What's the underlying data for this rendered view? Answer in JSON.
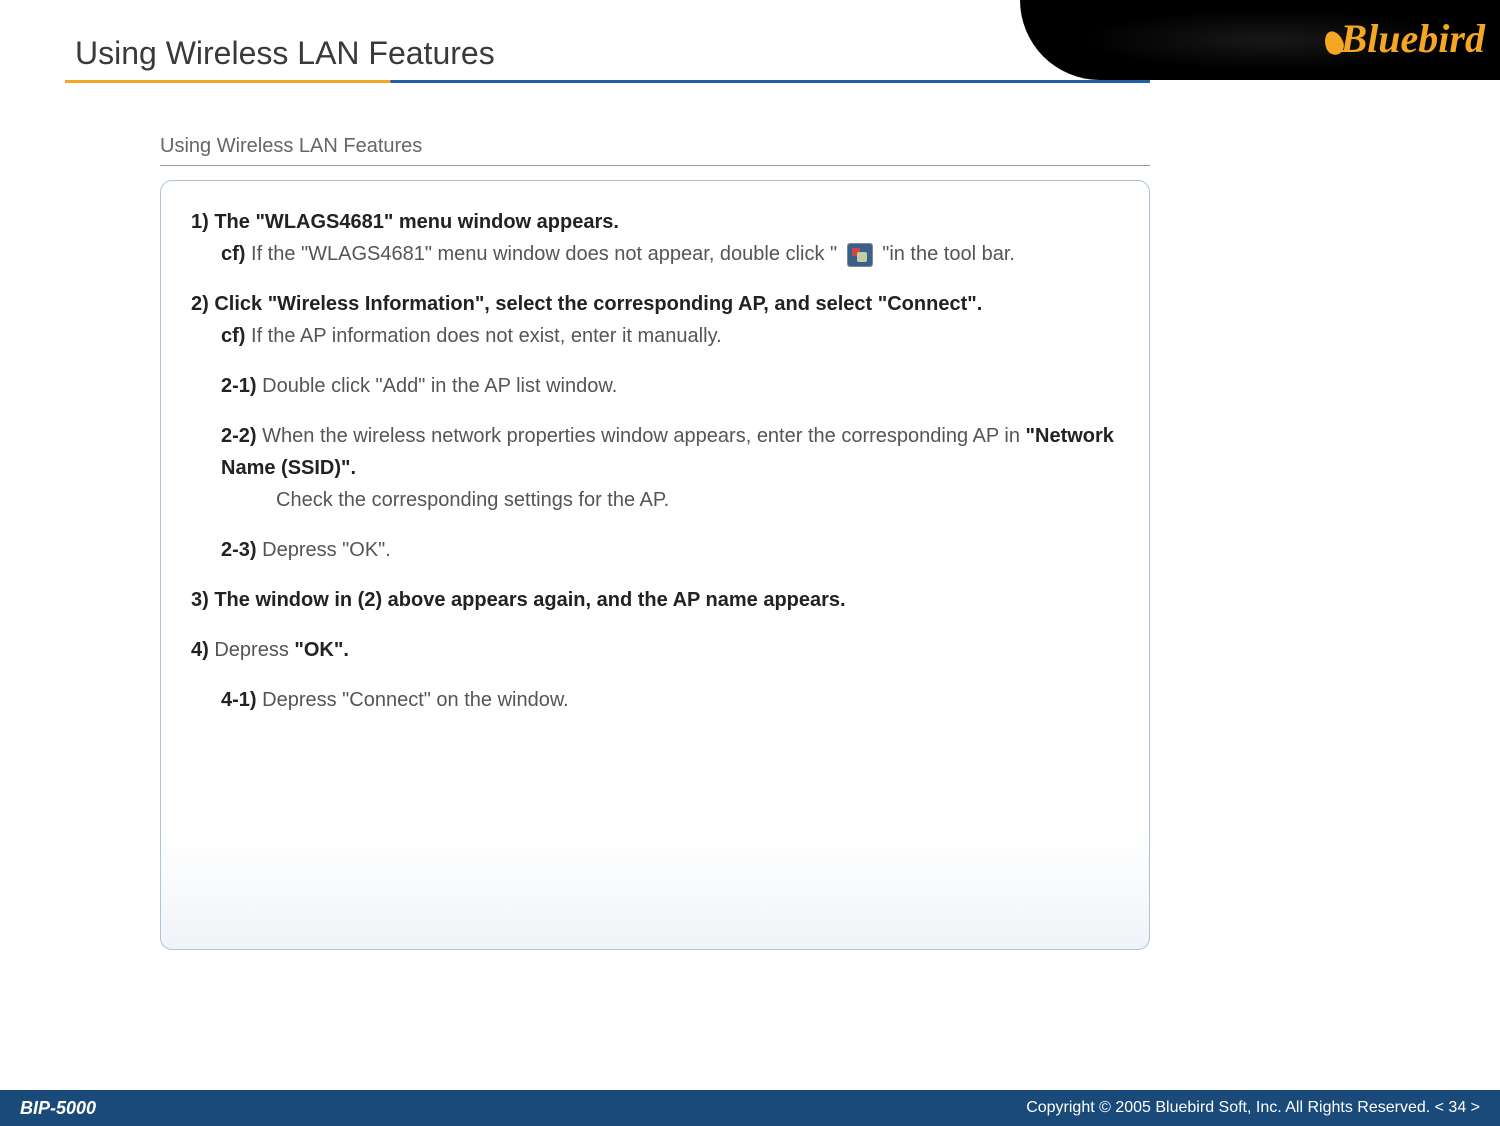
{
  "header": {
    "title": "Using Wireless LAN Features",
    "logo": "Bluebird"
  },
  "section": {
    "label": "Using Wireless LAN Features"
  },
  "content": {
    "step1_bold": "1) The \"WLAGS4681\" menu window appears.",
    "step1_cf_label": "cf)",
    "step1_cf_text1": " If the \"WLAGS4681\" menu window does not appear, double click \" ",
    "step1_cf_text2": " \"in the tool bar.",
    "step2_bold": "2) Click \"Wireless Information\", select the corresponding AP, and select \"Connect\".",
    "step2_cf_label": "cf)",
    "step2_cf_text": " If the AP information does not exist, enter it manually.",
    "step2_1_label": "2-1)",
    "step2_1_text": " Double click \"Add\" in the AP list window.",
    "step2_2_label": "2-2)",
    "step2_2_text1": " When the wireless network properties window appears, enter the corresponding AP in ",
    "step2_2_bold": "\"Network Name (SSID)\".",
    "step2_2_text2": " Check the corresponding  settings for the AP.",
    "step2_3_label": "2-3)",
    "step2_3_text": " Depress \"OK\".",
    "step3_bold": "3) The window in (2) above appears again, and the AP name appears.",
    "step4_label": "4)",
    "step4_text": " Depress ",
    "step4_bold2": "\"OK\".",
    "step4_1_label": "4-1)",
    "step4_1_text": " Depress \"Connect\" on the window."
  },
  "footer": {
    "product": "BIP-5000",
    "copyright": "Copyright © 2005 Bluebird Soft, Inc. All Rights Reserved.   < 34 >"
  }
}
